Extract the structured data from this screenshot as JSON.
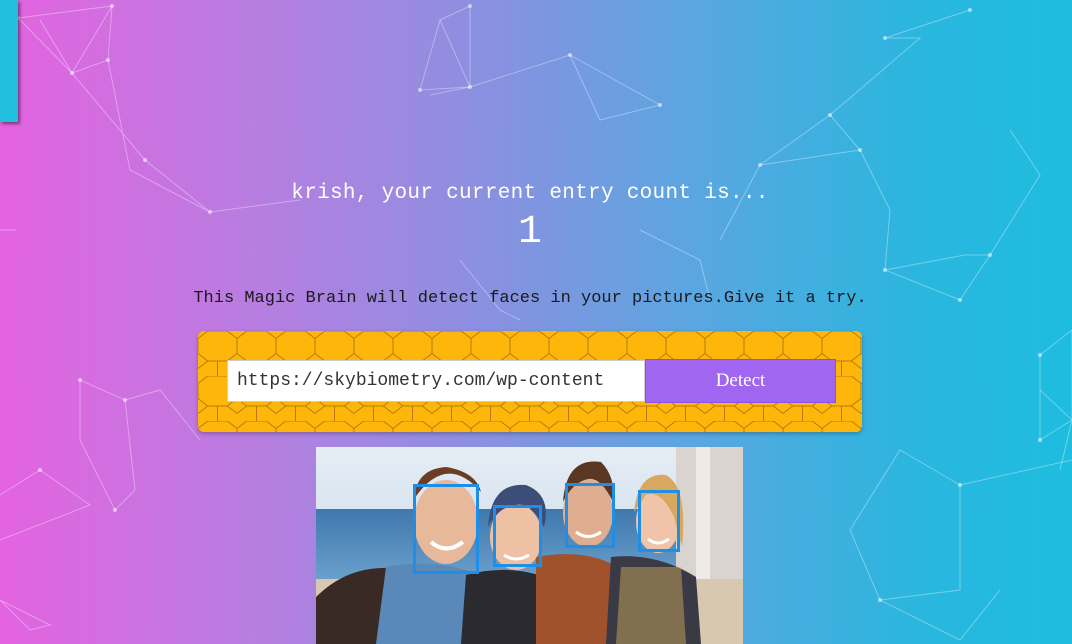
{
  "rank": {
    "name_line": "krish, your current entry count is...",
    "count": "1"
  },
  "intro": {
    "text": "This Magic Brain will detect faces in your pictures.Give it a try."
  },
  "form": {
    "url_value": "https://skybiometry.com/wp-content",
    "detect_label": "Detect"
  },
  "image": {
    "subject": "four smiling friends at the seaside",
    "detected_faces": 4
  },
  "colors": {
    "gradient_left": "#e463e0",
    "gradient_right": "#1ebddf",
    "panel_yellow": "#ffb60a",
    "button_purple": "#a066f0",
    "bbox_blue": "#1e8ee6"
  }
}
